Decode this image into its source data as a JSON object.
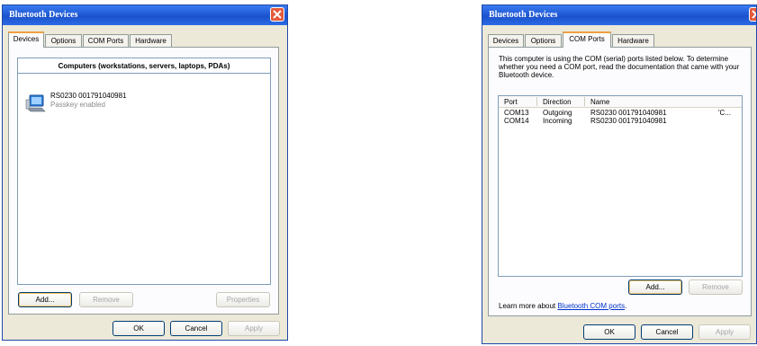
{
  "left_window": {
    "title": "Bluetooth Devices",
    "tabs": [
      {
        "label": "Devices",
        "active": true
      },
      {
        "label": "Options",
        "active": false
      },
      {
        "label": "COM Ports",
        "active": false
      },
      {
        "label": "Hardware",
        "active": false
      }
    ],
    "group_header": "Computers (workstations, servers, laptops, PDAs)",
    "device": {
      "name": "RS0230 001791040981",
      "status": "Passkey enabled",
      "icon": "computer-icon"
    },
    "buttons": {
      "add": "Add...",
      "remove": "Remove",
      "properties": "Properties"
    },
    "footer": {
      "ok": "OK",
      "cancel": "Cancel",
      "apply": "Apply"
    }
  },
  "right_window": {
    "title": "Bluetooth Devices",
    "tabs": [
      {
        "label": "Devices",
        "active": false
      },
      {
        "label": "Options",
        "active": false
      },
      {
        "label": "COM Ports",
        "active": true
      },
      {
        "label": "Hardware",
        "active": false
      }
    ],
    "description": "This computer is using the COM (serial) ports listed below. To determine whether you need a COM port, read the documentation that came with your Bluetooth device.",
    "columns": {
      "port": "Port",
      "direction": "Direction",
      "name": "Name"
    },
    "rows": [
      {
        "port": "COM13",
        "direction": "Outgoing",
        "name": "RS0230 001791040981",
        "extra": "'C..."
      },
      {
        "port": "COM14",
        "direction": "Incoming",
        "name": "RS0230 001791040981",
        "extra": ""
      }
    ],
    "buttons": {
      "add": "Add...",
      "remove": "Remove"
    },
    "learn_more_prefix": "Learn more about ",
    "learn_more_link": "Bluetooth COM ports",
    "learn_more_suffix": ".",
    "footer": {
      "ok": "OK",
      "cancel": "Cancel",
      "apply": "Apply"
    }
  },
  "colors": {
    "title_bar": "#2a63de",
    "close_button": "#e45a3c",
    "tab_highlight": "#f0a040",
    "dialog_bg": "#ece9d8"
  }
}
